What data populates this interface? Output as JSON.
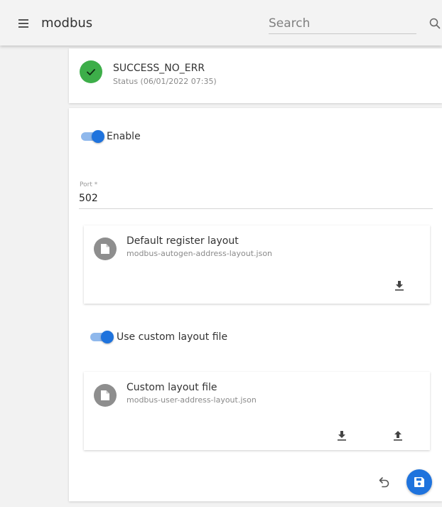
{
  "header": {
    "title": "modbus",
    "search_placeholder": "Search"
  },
  "status": {
    "title": "SUCCESS_NO_ERR",
    "subtitle": "Status (06/01/2022 07:35)"
  },
  "config": {
    "enable_label": "Enable",
    "enable_on": true,
    "port_label": "Port *",
    "port_value": "502",
    "default_layout": {
      "title": "Default register layout",
      "filename": "modbus-autogen-address-layout.json"
    },
    "custom_toggle_label": "Use custom layout file",
    "custom_toggle_on": true,
    "custom_layout": {
      "title": "Custom layout file",
      "filename": "modbus-user-address-layout.json"
    }
  },
  "colors": {
    "accent": "#1f73dd",
    "success": "#3dae49",
    "file_icon": "#8e8e8e"
  }
}
